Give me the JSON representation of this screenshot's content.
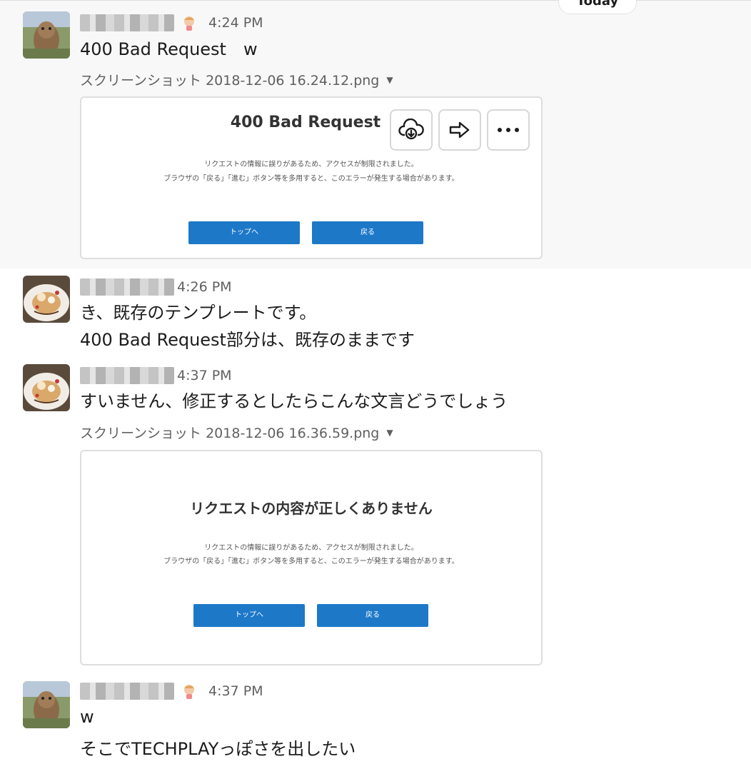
{
  "date_divider": {
    "label": "Today"
  },
  "messages": [
    {
      "time": "4:24 PM",
      "lines": [
        "400 Bad Request　w"
      ],
      "attachment": {
        "filename": "スクリーンショット 2018-12-06 16.24.12.png",
        "preview": {
          "heading": "400 Bad Request",
          "body": [
            "リクエストの情報に誤りがあるため、アクセスが制限されました。",
            "ブラウザの「戻る」「進む」ボタン等を多用すると、このエラーが発生する場合があります。"
          ],
          "buttons": [
            "トップへ",
            "戻る"
          ]
        },
        "actions": [
          "download-icon",
          "share-arrow-icon",
          "more-icon"
        ]
      }
    },
    {
      "time": "4:26 PM",
      "lines": [
        "き、既存のテンプレートです。",
        "400 Bad Request部分は、既存のままです"
      ]
    },
    {
      "time": "4:37 PM",
      "lines": [
        "すいません、修正するとしたらこんな文言どうでしょう"
      ],
      "attachment": {
        "filename": "スクリーンショット 2018-12-06 16.36.59.png",
        "preview": {
          "heading": "リクエストの内容が正しくありません",
          "body": [
            "リクエストの情報に誤りがあるため、アクセスが制限されました。",
            "ブラウザの「戻る」「進む」ボタン等を多用すると、このエラーが発生する場合があります。"
          ],
          "buttons": [
            "トップへ",
            "戻る"
          ]
        }
      }
    },
    {
      "time": "4:37 PM",
      "lines": [
        "w",
        "そこでTECHPLAYっぽさを出したい"
      ]
    }
  ],
  "colors": {
    "link_button": "#1d78c8",
    "highlight_bg": "#f8f8f8",
    "meta_text": "#616061"
  }
}
